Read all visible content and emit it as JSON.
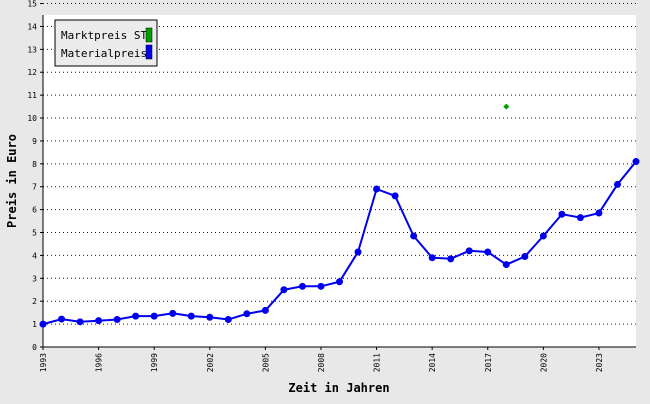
{
  "chart_data": {
    "type": "line",
    "title": "",
    "xlabel": "Zeit in Jahren",
    "ylabel": "Preis in Euro",
    "xlim": [
      1993,
      2025
    ],
    "ylim": [
      0,
      14
    ],
    "x_ticks": [
      "1993",
      "1996",
      "1999",
      "2002",
      "2005",
      "2008",
      "2011",
      "2014",
      "2017",
      "2020",
      "2023"
    ],
    "y_ticks": [
      "0",
      "1",
      "2",
      "3",
      "4",
      "5",
      "6",
      "7",
      "8",
      "9",
      "10",
      "11",
      "12",
      "13",
      "14",
      "15"
    ],
    "grid": "horizontal dotted",
    "legend_position": "top-left",
    "series": [
      {
        "name": "Marktpreis ST",
        "color": "#00a000",
        "marker": "diamond",
        "x": [
          2018
        ],
        "y": [
          10.5
        ]
      },
      {
        "name": "Materialpreis",
        "color": "#0000ee",
        "marker": "circle",
        "x": [
          1993,
          1994,
          1995,
          1996,
          1997,
          1998,
          1999,
          2000,
          2001,
          2002,
          2003,
          2004,
          2005,
          2006,
          2007,
          2008,
          2009,
          2010,
          2011,
          2012,
          2013,
          2014,
          2015,
          2016,
          2017,
          2018,
          2019,
          2020,
          2021,
          2022,
          2023,
          2024,
          2025
        ],
        "y": [
          1.0,
          1.22,
          1.1,
          1.15,
          1.2,
          1.35,
          1.35,
          1.47,
          1.35,
          1.3,
          1.2,
          1.45,
          1.6,
          2.5,
          2.65,
          2.65,
          2.85,
          4.15,
          6.9,
          6.6,
          4.85,
          3.9,
          3.85,
          4.2,
          4.15,
          3.6,
          3.95,
          4.85,
          5.8,
          5.65,
          5.85,
          7.1,
          8.1
        ]
      }
    ]
  }
}
